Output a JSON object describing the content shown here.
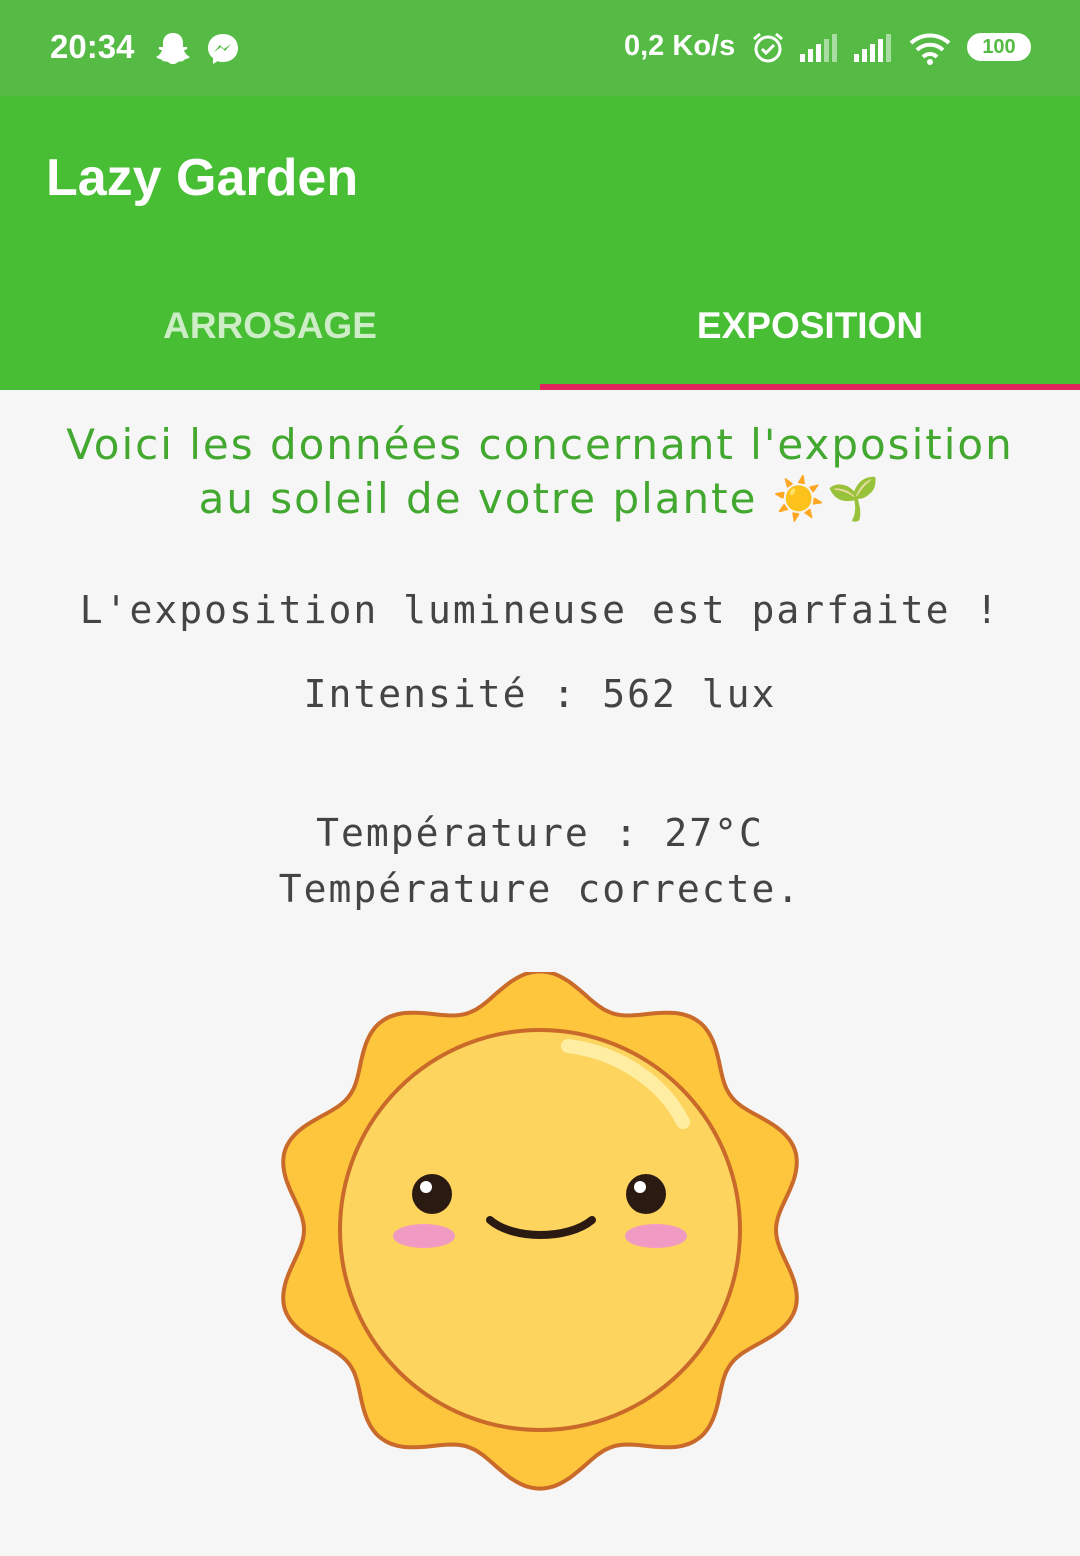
{
  "status_bar": {
    "time": "20:34",
    "net_speed": "0,2 Ko/s",
    "battery": "100",
    "icons": [
      "snapchat-icon",
      "messenger-icon",
      "alarm-icon",
      "signal-icon",
      "signal-icon",
      "wifi-icon",
      "battery-icon"
    ]
  },
  "app": {
    "title": "Lazy Garden"
  },
  "tabs": [
    {
      "label": "ARROSAGE"
    },
    {
      "label": "EXPOSITION"
    }
  ],
  "colors": {
    "status_bar": "#55bb44",
    "app_bar": "#48be35",
    "tab_indicator": "#e0245e",
    "intro_text": "#43a82f",
    "sun_fill": "#fdc63c",
    "sun_face": "#fdd45d"
  },
  "content": {
    "intro_line1": "Voici les données concernant l'exposition",
    "intro_line2": "au soleil de votre plante ☀️🌱",
    "exposure_status": "L'exposition lumineuse est parfaite !",
    "intensity": "Intensité : 562 lux",
    "temperature": "Température : 27°C",
    "temperature_status": "Température correcte."
  },
  "illustration": {
    "icon": "smiling-sun-icon"
  }
}
